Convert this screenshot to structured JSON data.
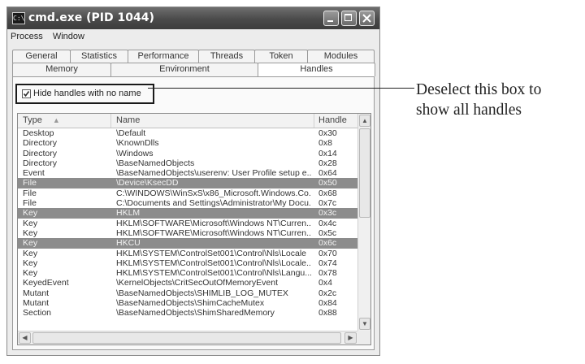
{
  "window": {
    "title": "cmd.exe (PID 1044)",
    "icon": "console-icon"
  },
  "menu": [
    "Process",
    "Window"
  ],
  "tabs_row1": [
    "General",
    "Statistics",
    "Performance",
    "Threads",
    "Token",
    "Modules"
  ],
  "tabs_row2": [
    "Memory",
    "Environment",
    "Handles"
  ],
  "active_tab": "Handles",
  "checkbox": {
    "label": "Hide handles with no name",
    "checked": true
  },
  "columns": {
    "type": "Type",
    "name": "Name",
    "handle": "Handle"
  },
  "rows": [
    {
      "type": "Desktop",
      "name": "\\Default",
      "handle": "0x30",
      "selected": false
    },
    {
      "type": "Directory",
      "name": "\\KnownDlls",
      "handle": "0x8",
      "selected": false
    },
    {
      "type": "Directory",
      "name": "\\Windows",
      "handle": "0x14",
      "selected": false
    },
    {
      "type": "Directory",
      "name": "\\BaseNamedObjects",
      "handle": "0x28",
      "selected": false
    },
    {
      "type": "Event",
      "name": "\\BaseNamedObjects\\userenv:  User Profile setup e...",
      "handle": "0x64",
      "selected": false
    },
    {
      "type": "File",
      "name": "\\Device\\KsecDD",
      "handle": "0x50",
      "selected": true
    },
    {
      "type": "File",
      "name": "C:\\WINDOWS\\WinSxS\\x86_Microsoft.Windows.Co...",
      "handle": "0x68",
      "selected": false
    },
    {
      "type": "File",
      "name": "C:\\Documents and Settings\\Administrator\\My Docu...",
      "handle": "0x7c",
      "selected": false
    },
    {
      "type": "Key",
      "name": "HKLM",
      "handle": "0x3c",
      "selected": true
    },
    {
      "type": "Key",
      "name": "HKLM\\SOFTWARE\\Microsoft\\Windows NT\\Curren...",
      "handle": "0x4c",
      "selected": false
    },
    {
      "type": "Key",
      "name": "HKLM\\SOFTWARE\\Microsoft\\Windows NT\\Curren...",
      "handle": "0x5c",
      "selected": false
    },
    {
      "type": "Key",
      "name": "HKCU",
      "handle": "0x6c",
      "selected": true
    },
    {
      "type": "Key",
      "name": "HKLM\\SYSTEM\\ControlSet001\\Control\\Nls\\Locale",
      "handle": "0x70",
      "selected": false
    },
    {
      "type": "Key",
      "name": "HKLM\\SYSTEM\\ControlSet001\\Control\\Nls\\Locale...",
      "handle": "0x74",
      "selected": false
    },
    {
      "type": "Key",
      "name": "HKLM\\SYSTEM\\ControlSet001\\Control\\Nls\\Langu...",
      "handle": "0x78",
      "selected": false
    },
    {
      "type": "KeyedEvent",
      "name": "\\KernelObjects\\CritSecOutOfMemoryEvent",
      "handle": "0x4",
      "selected": false
    },
    {
      "type": "Mutant",
      "name": "\\BaseNamedObjects\\SHIMLIB_LOG_MUTEX",
      "handle": "0x2c",
      "selected": false
    },
    {
      "type": "Mutant",
      "name": "\\BaseNamedObjects\\ShimCacheMutex",
      "handle": "0x84",
      "selected": false
    },
    {
      "type": "Section",
      "name": "\\BaseNamedObjects\\ShimSharedMemory",
      "handle": "0x88",
      "selected": false
    }
  ],
  "callout": {
    "line1": "Deselect this box to",
    "line2": "show all handles"
  },
  "colors": {
    "selection": "#8c8c8c",
    "titlebar": "#4a4a4a"
  }
}
